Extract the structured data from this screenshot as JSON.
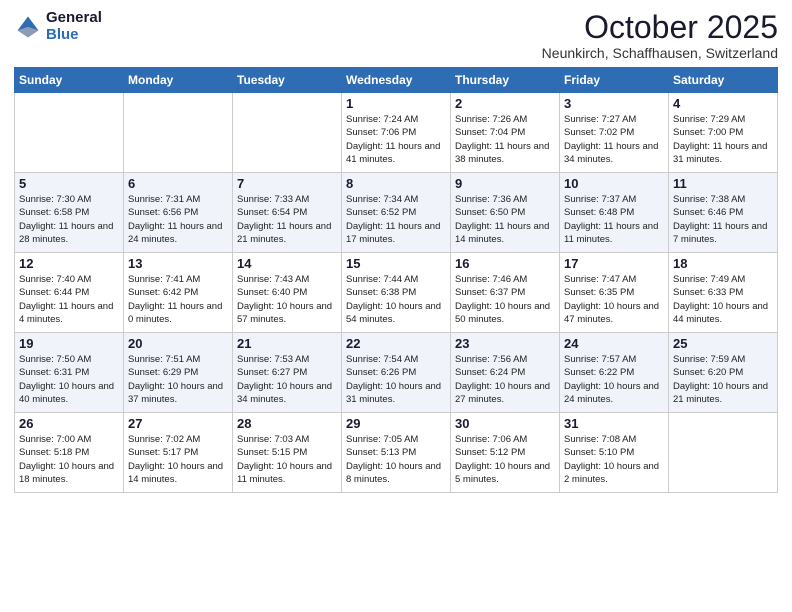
{
  "header": {
    "logo_general": "General",
    "logo_blue": "Blue",
    "month_title": "October 2025",
    "location": "Neunkirch, Schaffhausen, Switzerland"
  },
  "weekdays": [
    "Sunday",
    "Monday",
    "Tuesday",
    "Wednesday",
    "Thursday",
    "Friday",
    "Saturday"
  ],
  "weeks": [
    [
      {
        "day": "",
        "info": ""
      },
      {
        "day": "",
        "info": ""
      },
      {
        "day": "",
        "info": ""
      },
      {
        "day": "1",
        "info": "Sunrise: 7:24 AM\nSunset: 7:06 PM\nDaylight: 11 hours\nand 41 minutes."
      },
      {
        "day": "2",
        "info": "Sunrise: 7:26 AM\nSunset: 7:04 PM\nDaylight: 11 hours\nand 38 minutes."
      },
      {
        "day": "3",
        "info": "Sunrise: 7:27 AM\nSunset: 7:02 PM\nDaylight: 11 hours\nand 34 minutes."
      },
      {
        "day": "4",
        "info": "Sunrise: 7:29 AM\nSunset: 7:00 PM\nDaylight: 11 hours\nand 31 minutes."
      }
    ],
    [
      {
        "day": "5",
        "info": "Sunrise: 7:30 AM\nSunset: 6:58 PM\nDaylight: 11 hours\nand 28 minutes."
      },
      {
        "day": "6",
        "info": "Sunrise: 7:31 AM\nSunset: 6:56 PM\nDaylight: 11 hours\nand 24 minutes."
      },
      {
        "day": "7",
        "info": "Sunrise: 7:33 AM\nSunset: 6:54 PM\nDaylight: 11 hours\nand 21 minutes."
      },
      {
        "day": "8",
        "info": "Sunrise: 7:34 AM\nSunset: 6:52 PM\nDaylight: 11 hours\nand 17 minutes."
      },
      {
        "day": "9",
        "info": "Sunrise: 7:36 AM\nSunset: 6:50 PM\nDaylight: 11 hours\nand 14 minutes."
      },
      {
        "day": "10",
        "info": "Sunrise: 7:37 AM\nSunset: 6:48 PM\nDaylight: 11 hours\nand 11 minutes."
      },
      {
        "day": "11",
        "info": "Sunrise: 7:38 AM\nSunset: 6:46 PM\nDaylight: 11 hours\nand 7 minutes."
      }
    ],
    [
      {
        "day": "12",
        "info": "Sunrise: 7:40 AM\nSunset: 6:44 PM\nDaylight: 11 hours\nand 4 minutes."
      },
      {
        "day": "13",
        "info": "Sunrise: 7:41 AM\nSunset: 6:42 PM\nDaylight: 11 hours\nand 0 minutes."
      },
      {
        "day": "14",
        "info": "Sunrise: 7:43 AM\nSunset: 6:40 PM\nDaylight: 10 hours\nand 57 minutes."
      },
      {
        "day": "15",
        "info": "Sunrise: 7:44 AM\nSunset: 6:38 PM\nDaylight: 10 hours\nand 54 minutes."
      },
      {
        "day": "16",
        "info": "Sunrise: 7:46 AM\nSunset: 6:37 PM\nDaylight: 10 hours\nand 50 minutes."
      },
      {
        "day": "17",
        "info": "Sunrise: 7:47 AM\nSunset: 6:35 PM\nDaylight: 10 hours\nand 47 minutes."
      },
      {
        "day": "18",
        "info": "Sunrise: 7:49 AM\nSunset: 6:33 PM\nDaylight: 10 hours\nand 44 minutes."
      }
    ],
    [
      {
        "day": "19",
        "info": "Sunrise: 7:50 AM\nSunset: 6:31 PM\nDaylight: 10 hours\nand 40 minutes."
      },
      {
        "day": "20",
        "info": "Sunrise: 7:51 AM\nSunset: 6:29 PM\nDaylight: 10 hours\nand 37 minutes."
      },
      {
        "day": "21",
        "info": "Sunrise: 7:53 AM\nSunset: 6:27 PM\nDaylight: 10 hours\nand 34 minutes."
      },
      {
        "day": "22",
        "info": "Sunrise: 7:54 AM\nSunset: 6:26 PM\nDaylight: 10 hours\nand 31 minutes."
      },
      {
        "day": "23",
        "info": "Sunrise: 7:56 AM\nSunset: 6:24 PM\nDaylight: 10 hours\nand 27 minutes."
      },
      {
        "day": "24",
        "info": "Sunrise: 7:57 AM\nSunset: 6:22 PM\nDaylight: 10 hours\nand 24 minutes."
      },
      {
        "day": "25",
        "info": "Sunrise: 7:59 AM\nSunset: 6:20 PM\nDaylight: 10 hours\nand 21 minutes."
      }
    ],
    [
      {
        "day": "26",
        "info": "Sunrise: 7:00 AM\nSunset: 5:18 PM\nDaylight: 10 hours\nand 18 minutes."
      },
      {
        "day": "27",
        "info": "Sunrise: 7:02 AM\nSunset: 5:17 PM\nDaylight: 10 hours\nand 14 minutes."
      },
      {
        "day": "28",
        "info": "Sunrise: 7:03 AM\nSunset: 5:15 PM\nDaylight: 10 hours\nand 11 minutes."
      },
      {
        "day": "29",
        "info": "Sunrise: 7:05 AM\nSunset: 5:13 PM\nDaylight: 10 hours\nand 8 minutes."
      },
      {
        "day": "30",
        "info": "Sunrise: 7:06 AM\nSunset: 5:12 PM\nDaylight: 10 hours\nand 5 minutes."
      },
      {
        "day": "31",
        "info": "Sunrise: 7:08 AM\nSunset: 5:10 PM\nDaylight: 10 hours\nand 2 minutes."
      },
      {
        "day": "",
        "info": ""
      }
    ]
  ]
}
